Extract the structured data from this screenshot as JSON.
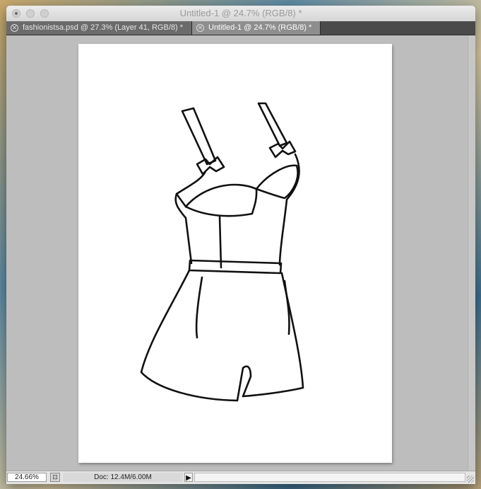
{
  "window": {
    "title": "Untitled-1 @ 24.7% (RGB/8) *"
  },
  "tabs": [
    {
      "label": "fashionistsa.psd @ 27.3% (Layer 41, RGB/8) *",
      "active": false
    },
    {
      "label": "Untitled-1 @ 24.7% (RGB/8) *",
      "active": true
    }
  ],
  "icons": {
    "tab_close": "✕",
    "status_menu": "▶",
    "status_icon": "⊡"
  },
  "status": {
    "zoom": "24.66%",
    "doc_info": "Doc: 12.4M/6.00M"
  },
  "colors": {
    "canvas_bg": "#bdbdbd",
    "tab_active": "#8e8e8e",
    "tab_inactive": "#6b6b6b"
  }
}
